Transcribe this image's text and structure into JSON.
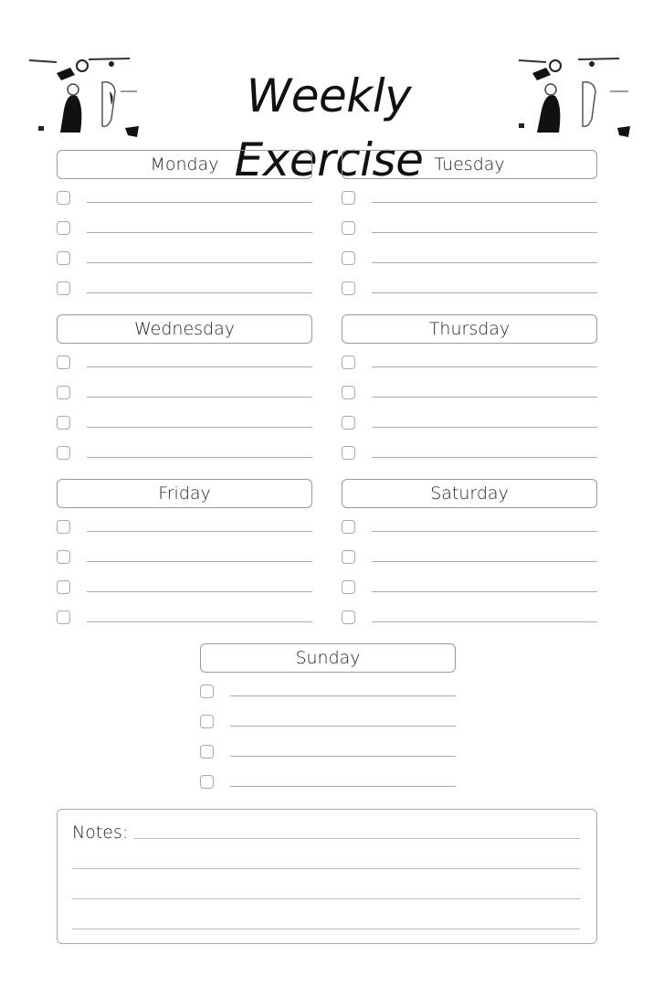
{
  "header": {
    "title": "Weekly Exercise",
    "image_left": "gym-photo",
    "image_right": "gym-photo"
  },
  "days": [
    {
      "label": "Monday",
      "entries": [
        "",
        "",
        "",
        ""
      ]
    },
    {
      "label": "Tuesday",
      "entries": [
        "",
        "",
        "",
        ""
      ]
    },
    {
      "label": "Wednesday",
      "entries": [
        "",
        "",
        "",
        ""
      ]
    },
    {
      "label": "Thursday",
      "entries": [
        "",
        "",
        "",
        ""
      ]
    },
    {
      "label": "Friday",
      "entries": [
        "",
        "",
        "",
        ""
      ]
    },
    {
      "label": "Saturday",
      "entries": [
        "",
        "",
        "",
        ""
      ]
    },
    {
      "label": "Sunday",
      "entries": [
        "",
        "",
        "",
        ""
      ]
    }
  ],
  "notes": {
    "label": "Notes:",
    "lines": [
      "",
      "",
      "",
      ""
    ]
  }
}
